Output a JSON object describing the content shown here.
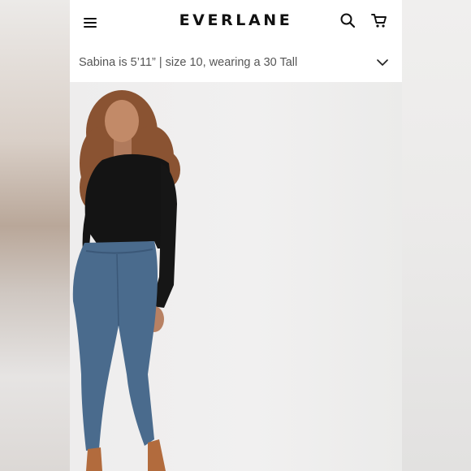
{
  "header": {
    "brand": "EVERLANE",
    "menu_icon": "hamburger-menu-icon",
    "search_icon": "search-icon",
    "cart_icon": "shopping-cart-icon"
  },
  "fit_info": {
    "text": "Sabina is 5’11” | size 10, wearing a 30 Tall",
    "toggle_icon": "chevron-down-icon"
  },
  "colors": {
    "brand_text": "#111111",
    "background": "#ffffff",
    "photo_background": "#efeeee"
  }
}
